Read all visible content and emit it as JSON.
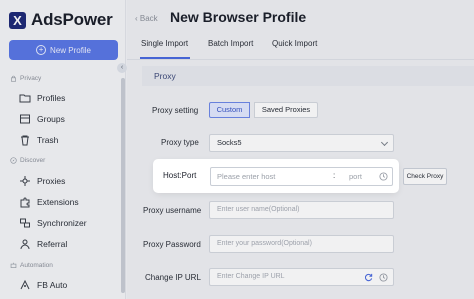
{
  "app": {
    "logo_text": "AdsPower",
    "logo_mark": "X"
  },
  "sidebar": {
    "new_profile_label": "New Profile",
    "collapse_glyph": "‹",
    "sections": [
      {
        "label": "Privacy",
        "icon": "lock-icon"
      },
      {
        "label": "Discover",
        "icon": "compass-icon"
      },
      {
        "label": "Automation",
        "icon": "robot-icon"
      }
    ],
    "items": [
      {
        "label": "Profiles",
        "icon": "folder-icon"
      },
      {
        "label": "Groups",
        "icon": "groups-icon"
      },
      {
        "label": "Trash",
        "icon": "trash-icon"
      },
      {
        "label": "Proxies",
        "icon": "proxies-icon"
      },
      {
        "label": "Extensions",
        "icon": "extensions-icon"
      },
      {
        "label": "Synchronizer",
        "icon": "synchronizer-icon"
      },
      {
        "label": "Referral",
        "icon": "referral-icon"
      },
      {
        "label": "FB Auto",
        "icon": "fb-auto-icon"
      }
    ]
  },
  "header": {
    "back_label": "Back",
    "title": "New Browser Profile"
  },
  "tabs": [
    "Single Import",
    "Batch Import",
    "Quick Import"
  ],
  "panel": {
    "title": "Proxy"
  },
  "form": {
    "proxy_setting_label": "Proxy setting",
    "proxy_setting_options": [
      "Custom",
      "Saved Proxies"
    ],
    "proxy_type_label": "Proxy type",
    "proxy_type_value": "Socks5",
    "host_port_label": "Host:Port",
    "host_placeholder": "Please enter host",
    "port_separator": ":",
    "port_placeholder": "port",
    "check_proxy_label": "Check Proxy",
    "username_label": "Proxy username",
    "username_placeholder": "Enter user name(Optional)",
    "password_label": "Proxy Password",
    "password_placeholder": "Enter your password(Optional)",
    "change_ip_label": "Change IP URL",
    "change_ip_placeholder": "Enter Change IP URL"
  },
  "colors": {
    "accent": "#5a78e6",
    "active_tab": "#4a6ae0",
    "logo": "#1e2a78"
  }
}
